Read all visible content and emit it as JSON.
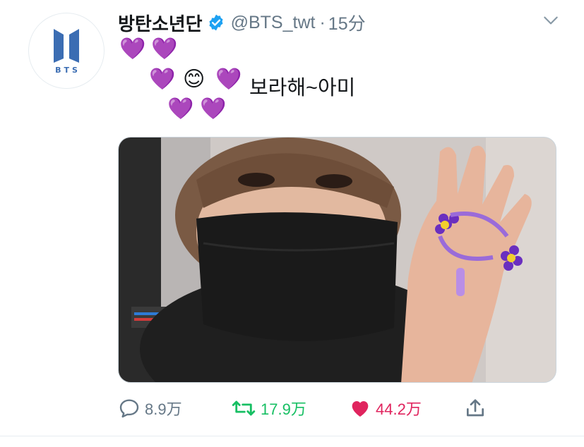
{
  "tweet": {
    "display_name": "방탄소년단",
    "handle": "@BTS_twt",
    "separator": "·",
    "time": "15分",
    "avatar_logo_text": "BTS",
    "text_line2": "보라해~아미",
    "emoji_heart": "💜",
    "emoji_smile": "😊"
  },
  "actions": {
    "replies": "8.9万",
    "retweets": "17.9万",
    "likes": "44.2万"
  },
  "colors": {
    "verified": "#1da1f2",
    "retweet": "#17bf63",
    "like": "#e0245e",
    "muted": "#657786",
    "logo": "#3b6db3"
  },
  "icons": [
    "bts-logo-icon",
    "verified-badge-icon",
    "chevron-down-icon",
    "reply-icon",
    "retweet-icon",
    "heart-filled-icon",
    "share-icon"
  ]
}
